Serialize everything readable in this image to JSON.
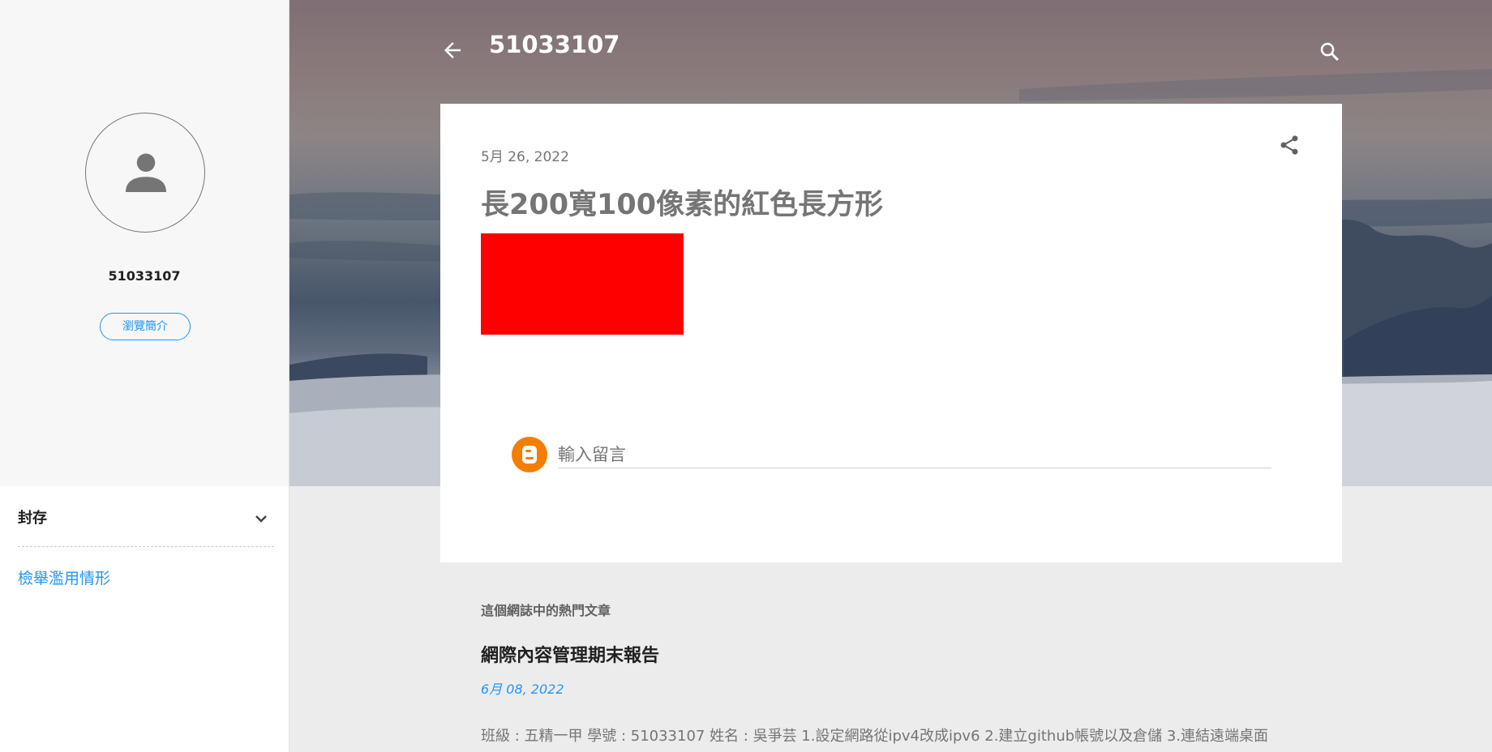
{
  "header": {
    "blog_title": "51033107"
  },
  "sidebar": {
    "profile_name": "51033107",
    "profile_button_label": "瀏覽簡介",
    "archive_label": "封存",
    "report_link_label": "檢舉濫用情形"
  },
  "post": {
    "date": "5月 26, 2022",
    "title": "長200寬100像素的紅色長方形",
    "rect_color": "#ff0000",
    "comment_placeholder": "輸入留言"
  },
  "popular": {
    "heading": "這個網誌中的熱門文章",
    "items": [
      {
        "title": "網際內容管理期末報告",
        "date": "6月 08, 2022",
        "snippet": "班級 : 五精一甲     學號 : 51033107      姓名 : 吳爭芸 1.設定網路從ipv4改成ipv6 2.建立github帳號以及倉儲 3.連結遠端桌面"
      }
    ]
  },
  "icons": {
    "back": "arrow-back-icon",
    "search": "search-icon",
    "share": "share-icon",
    "avatar": "person-icon",
    "chevron": "chevron-down-icon",
    "blogger": "blogger-icon"
  },
  "colors": {
    "accent": "#2196f3",
    "blogger_orange": "#f57d00"
  }
}
